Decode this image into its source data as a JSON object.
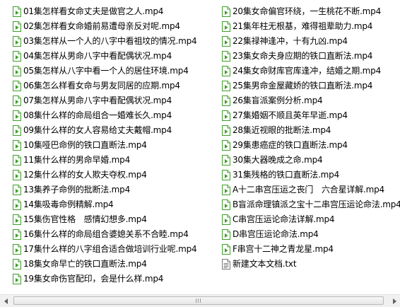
{
  "files": {
    "column1": [
      {
        "name": "01集怎样看女命丈夫是做官之人.mp4",
        "icon": "video-file-icon"
      },
      {
        "name": "02集怎样看女命婚前易遭母亲反对呢.mp4",
        "icon": "video-file-icon"
      },
      {
        "name": "03集怎样从一个人的八字中看祖坟的情况.mp4",
        "icon": "video-file-icon"
      },
      {
        "name": "04集怎样从男命八字中看配偶状况.mp4",
        "icon": "video-file-icon"
      },
      {
        "name": "05集怎样从八字中看一个人的居住环境.mp4",
        "icon": "video-file-icon"
      },
      {
        "name": "06集怎么样看女命与男友同居的应期.mp4",
        "icon": "video-file-icon"
      },
      {
        "name": "07集怎样从男命八字中看配偶状况.mp4",
        "icon": "video-file-icon"
      },
      {
        "name": "08集什么样的命局组合一婚难长久.mp4",
        "icon": "video-file-icon"
      },
      {
        "name": "09集什么样的女人容易给丈夫戴帽.mp4",
        "icon": "video-file-icon"
      },
      {
        "name": "10集哑巴命例的铁口直断法.mp4",
        "icon": "video-file-icon"
      },
      {
        "name": "11集什么样的男命早婚.mp4",
        "icon": "video-file-icon"
      },
      {
        "name": "12集什么样的女人欺夫夺权.mp4",
        "icon": "video-file-icon"
      },
      {
        "name": "13集养子命例的批断法.mp4",
        "icon": "video-file-icon"
      },
      {
        "name": "14集吸毒命例精解.mp4",
        "icon": "video-file-icon"
      },
      {
        "name": "15集伤官性格　感情幻想多.mp4",
        "icon": "video-file-icon"
      },
      {
        "name": "16集什么样的命局组合婆媳关系不合睦.mp4",
        "icon": "video-file-icon"
      },
      {
        "name": "17集什么样的八字组合适合做培训行业呢.mp4",
        "icon": "video-file-icon"
      },
      {
        "name": "18集女命早亡的铁口直断法.mp4",
        "icon": "video-file-icon"
      },
      {
        "name": "19集女命伤官配印，会是什么样.mp4",
        "icon": "video-file-icon"
      }
    ],
    "column2": [
      {
        "name": "20集女命偏官环绕，一生桃花不断.mp4",
        "icon": "video-file-icon"
      },
      {
        "name": "21集年柱无根基，难得祖辈助力.mp4",
        "icon": "video-file-icon"
      },
      {
        "name": "22集禄神逢冲，十有九凶.mp4",
        "icon": "video-file-icon"
      },
      {
        "name": "23集女命夫身应期的铁口直断法.mp4",
        "icon": "video-file-icon"
      },
      {
        "name": "24集女命财库官库逢冲，结婚之期.mp4",
        "icon": "video-file-icon"
      },
      {
        "name": "25集男命金屋藏娇的铁口直断法.mp4",
        "icon": "video-file-icon"
      },
      {
        "name": "26集盲派案例分析.mp4",
        "icon": "video-file-icon"
      },
      {
        "name": "27集婚姻不顺且英年早逝.mp4",
        "icon": "video-file-icon"
      },
      {
        "name": "28集近视眼的批断法.mp4",
        "icon": "video-file-icon"
      },
      {
        "name": "29集患癌症的铁口直断法.mp4",
        "icon": "video-file-icon"
      },
      {
        "name": "30集大器晚成之命.mp4",
        "icon": "video-file-icon"
      },
      {
        "name": "31集残格的铁口直断法.mp4",
        "icon": "video-file-icon"
      },
      {
        "name": "A十二串宫压运之丧门　六合星详解.mp4",
        "icon": "video-file-icon"
      },
      {
        "name": "B盲派命理镇派之宝十二串宫压运论命法.mp4",
        "icon": "video-file-icon"
      },
      {
        "name": "C串宫压运论命法详解.mp4",
        "icon": "video-file-icon"
      },
      {
        "name": "D串宫压运论命法.mp4",
        "icon": "video-file-icon"
      },
      {
        "name": "F串宫十二神之青龙星.mp4",
        "icon": "video-file-icon"
      },
      {
        "name": "新建文本文档.txt",
        "icon": "text-file-icon"
      }
    ]
  },
  "scrollbar": {
    "left_arrow_icon": "triangle-left-icon",
    "right_arrow_icon": "triangle-right-icon"
  },
  "colors": {
    "video_icon_green": "#3f9d2a",
    "scrollbar_bg": "#f0f0f0"
  }
}
